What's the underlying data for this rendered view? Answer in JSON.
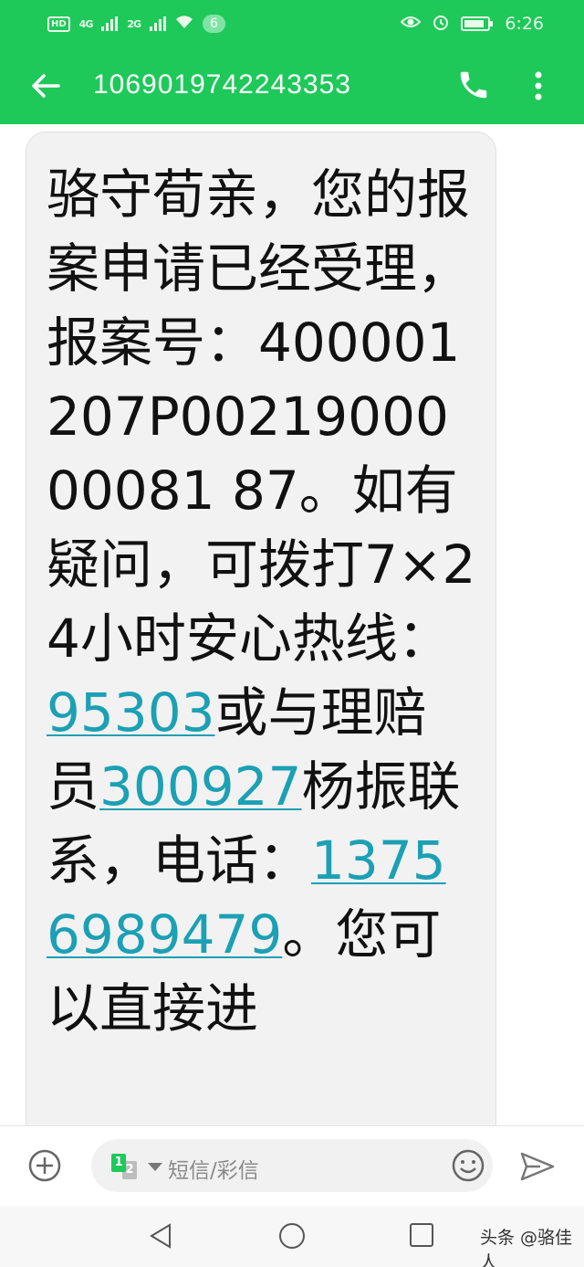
{
  "status_bar": {
    "hd": "HD",
    "net1": "4G",
    "net2": "2G",
    "notification_count": "6",
    "time": "6:26",
    "icons": [
      "signal-icon",
      "wifi-icon",
      "eye-comfort-icon",
      "alarm-icon",
      "battery-icon"
    ]
  },
  "header": {
    "title": "1069019742243353",
    "icons": [
      "back-arrow-icon",
      "phone-icon",
      "more-vert-icon"
    ]
  },
  "message": {
    "segments": [
      {
        "text": "骆守荀亲，您的报案申请已经受理，报案号：400001207P0021900000081 87。如有疑问，可拨打7×24小时安心热线：",
        "link": false
      },
      {
        "text": "95303",
        "link": true
      },
      {
        "text": "或与理赔员",
        "link": false
      },
      {
        "text": "300927",
        "link": true
      },
      {
        "text": "杨振联系，电话：",
        "link": false
      },
      {
        "text": "13756989479",
        "link": true
      },
      {
        "text": "。您可以直接进",
        "link": false
      }
    ]
  },
  "composer": {
    "sim1": "1",
    "sim2": "2",
    "placeholder": "短信/彩信",
    "icons": [
      "add-icon",
      "sim-switch-icon",
      "emoji-icon",
      "send-icon"
    ]
  },
  "navbar": {
    "watermark": "头条 @骆佳人",
    "icons": [
      "nav-back-icon",
      "nav-home-icon",
      "nav-recent-icon"
    ]
  },
  "colors": {
    "accent": "#1ec95a",
    "link": "#1ba0b4",
    "bubble": "#f2f2f2"
  }
}
